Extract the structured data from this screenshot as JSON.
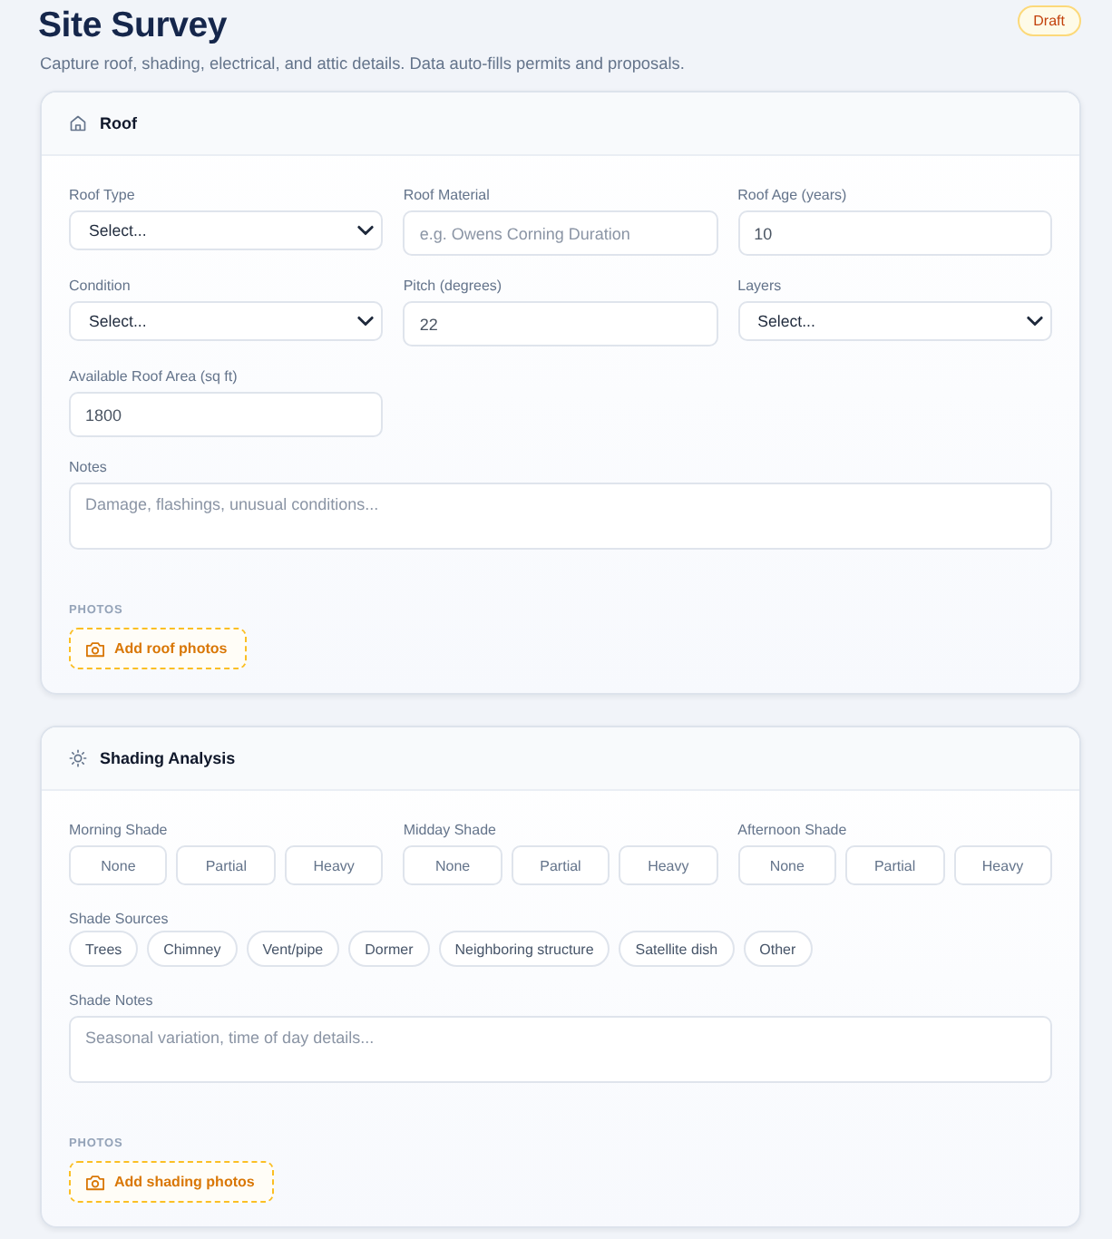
{
  "page": {
    "title": "Site Survey",
    "status": "Draft",
    "subtitle": "Capture roof, shading, electrical, and attic details. Data auto-fills permits and proposals."
  },
  "sections": [
    {
      "kind": "roof",
      "title": "Roof",
      "fields": [
        {
          "kind": "select",
          "label": "Roof Type",
          "value": "Select..."
        },
        {
          "kind": "text",
          "label": "Roof Material",
          "placeholder": "e.g. Owens Corning Duration"
        },
        {
          "kind": "text",
          "label": "Roof Age (years)",
          "value": "10"
        },
        {
          "kind": "select",
          "label": "Condition",
          "value": "Select..."
        },
        {
          "kind": "text",
          "label": "Pitch (degrees)",
          "value": "22"
        },
        {
          "kind": "select",
          "label": "Layers",
          "value": "Select..."
        },
        {
          "kind": "text",
          "label": "Available Roof Area (sq ft)",
          "value": "1800"
        },
        {
          "kind": "textarea",
          "label": "Notes",
          "placeholder": "Damage, flashings, unusual conditions..."
        }
      ],
      "photos": {
        "label": "PHOTOS",
        "button": "Add roof photos"
      }
    },
    {
      "kind": "shading",
      "title": "Shading Analysis",
      "shade_times": [
        {
          "label": "Morning Shade",
          "options": [
            {
              "label": "None",
              "selected": false
            },
            {
              "label": "Partial",
              "selected": false
            },
            {
              "label": "Heavy",
              "selected": false
            }
          ]
        },
        {
          "label": "Midday Shade",
          "options": [
            {
              "label": "None",
              "selected": false
            },
            {
              "label": "Partial",
              "selected": false
            },
            {
              "label": "Heavy",
              "selected": false
            }
          ]
        },
        {
          "label": "Afternoon Shade",
          "options": [
            {
              "label": "None",
              "selected": false
            },
            {
              "label": "Partial",
              "selected": false
            },
            {
              "label": "Heavy",
              "selected": false
            }
          ]
        }
      ],
      "shade_sources": {
        "label": "Shade Sources",
        "options": [
          {
            "label": "Trees",
            "selected": false
          },
          {
            "label": "Chimney",
            "selected": false
          },
          {
            "label": "Vent/pipe",
            "selected": false
          },
          {
            "label": "Dormer",
            "selected": false
          },
          {
            "label": "Neighboring structure",
            "selected": false
          },
          {
            "label": "Satellite dish",
            "selected": false
          },
          {
            "label": "Other",
            "selected": false
          }
        ]
      },
      "fields": [
        {
          "kind": "textarea",
          "label": "Shade Notes",
          "placeholder": "Seasonal variation, time of day details..."
        }
      ],
      "photos": {
        "label": "PHOTOS",
        "button": "Add shading photos"
      }
    }
  ]
}
